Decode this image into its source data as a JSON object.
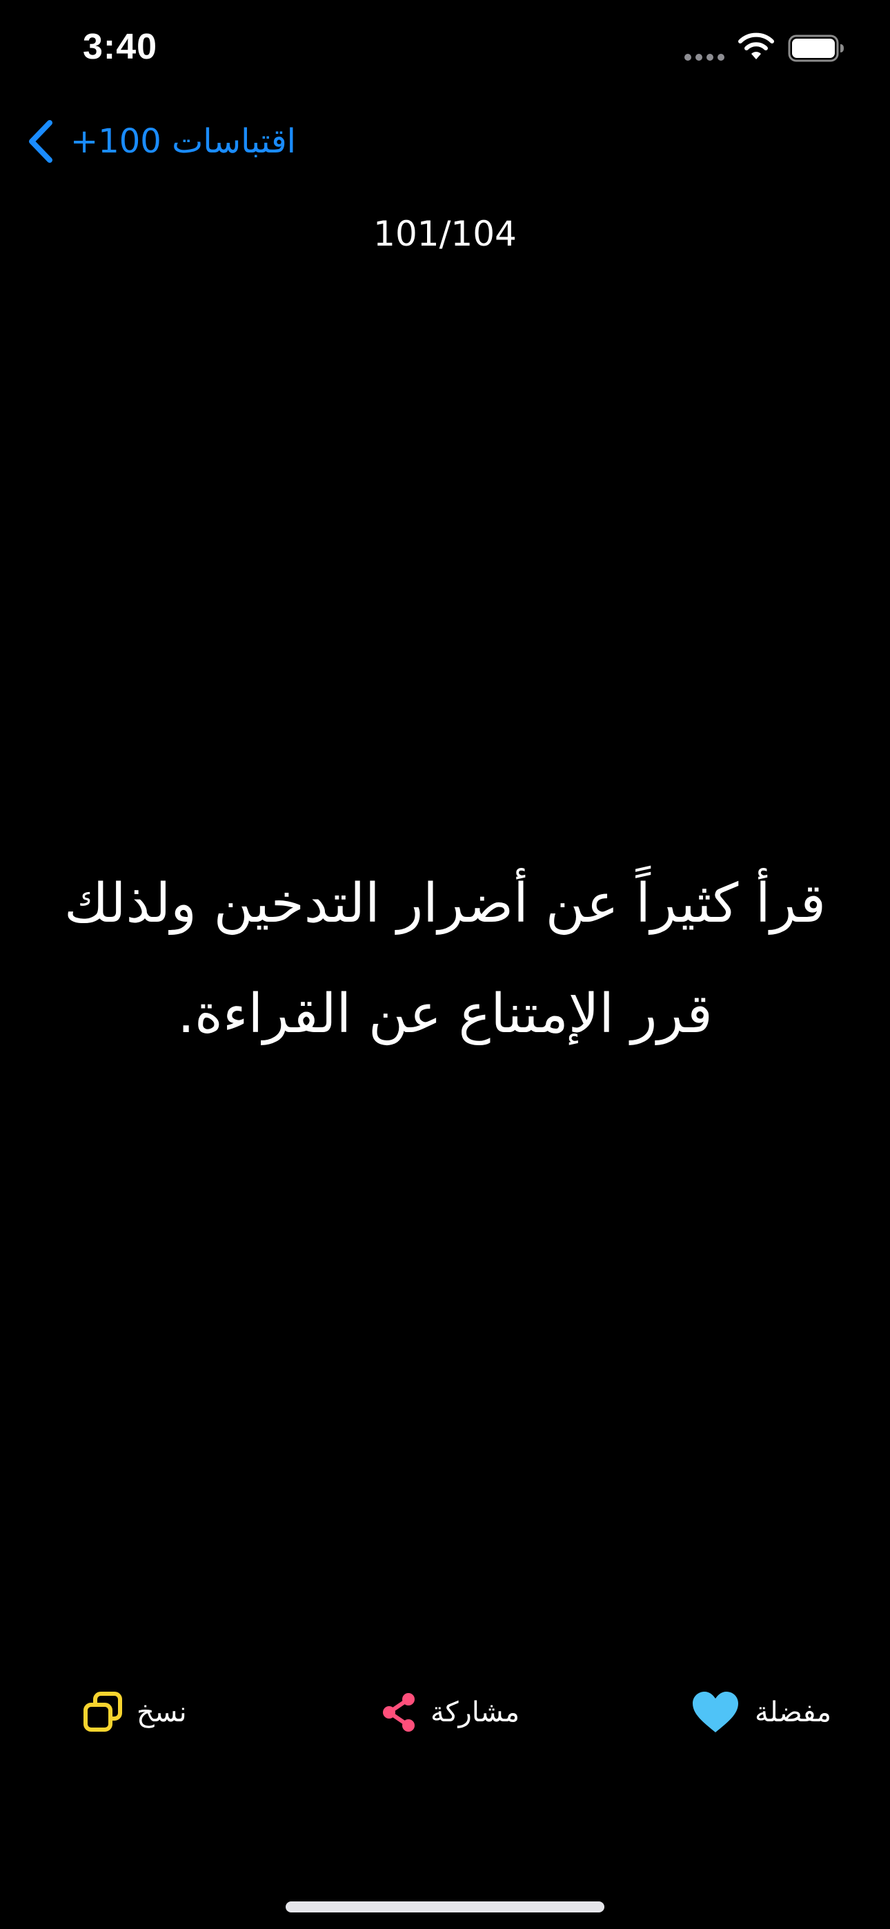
{
  "status_bar": {
    "time": "3:40"
  },
  "nav": {
    "back_label": "+100 اقتباسات"
  },
  "page_counter": "101/104",
  "quote": {
    "text": "قرأ كثيراً عن أضرار التدخين ولذلك قرر الإمتناع عن القراءة."
  },
  "actions": {
    "copy_label": "نسخ",
    "share_label": "مشاركة",
    "favorite_label": "مفضلة"
  },
  "icons": {
    "back": "chevron-left-icon",
    "copy": "copy-icon",
    "share": "share-icon",
    "favorite": "heart-icon"
  },
  "colors": {
    "background": "#000000",
    "accent_blue": "#1a8cff",
    "copy_icon": "#f7d42f",
    "share_icon": "#ff4f7b",
    "heart_icon": "#4fc3f7"
  }
}
